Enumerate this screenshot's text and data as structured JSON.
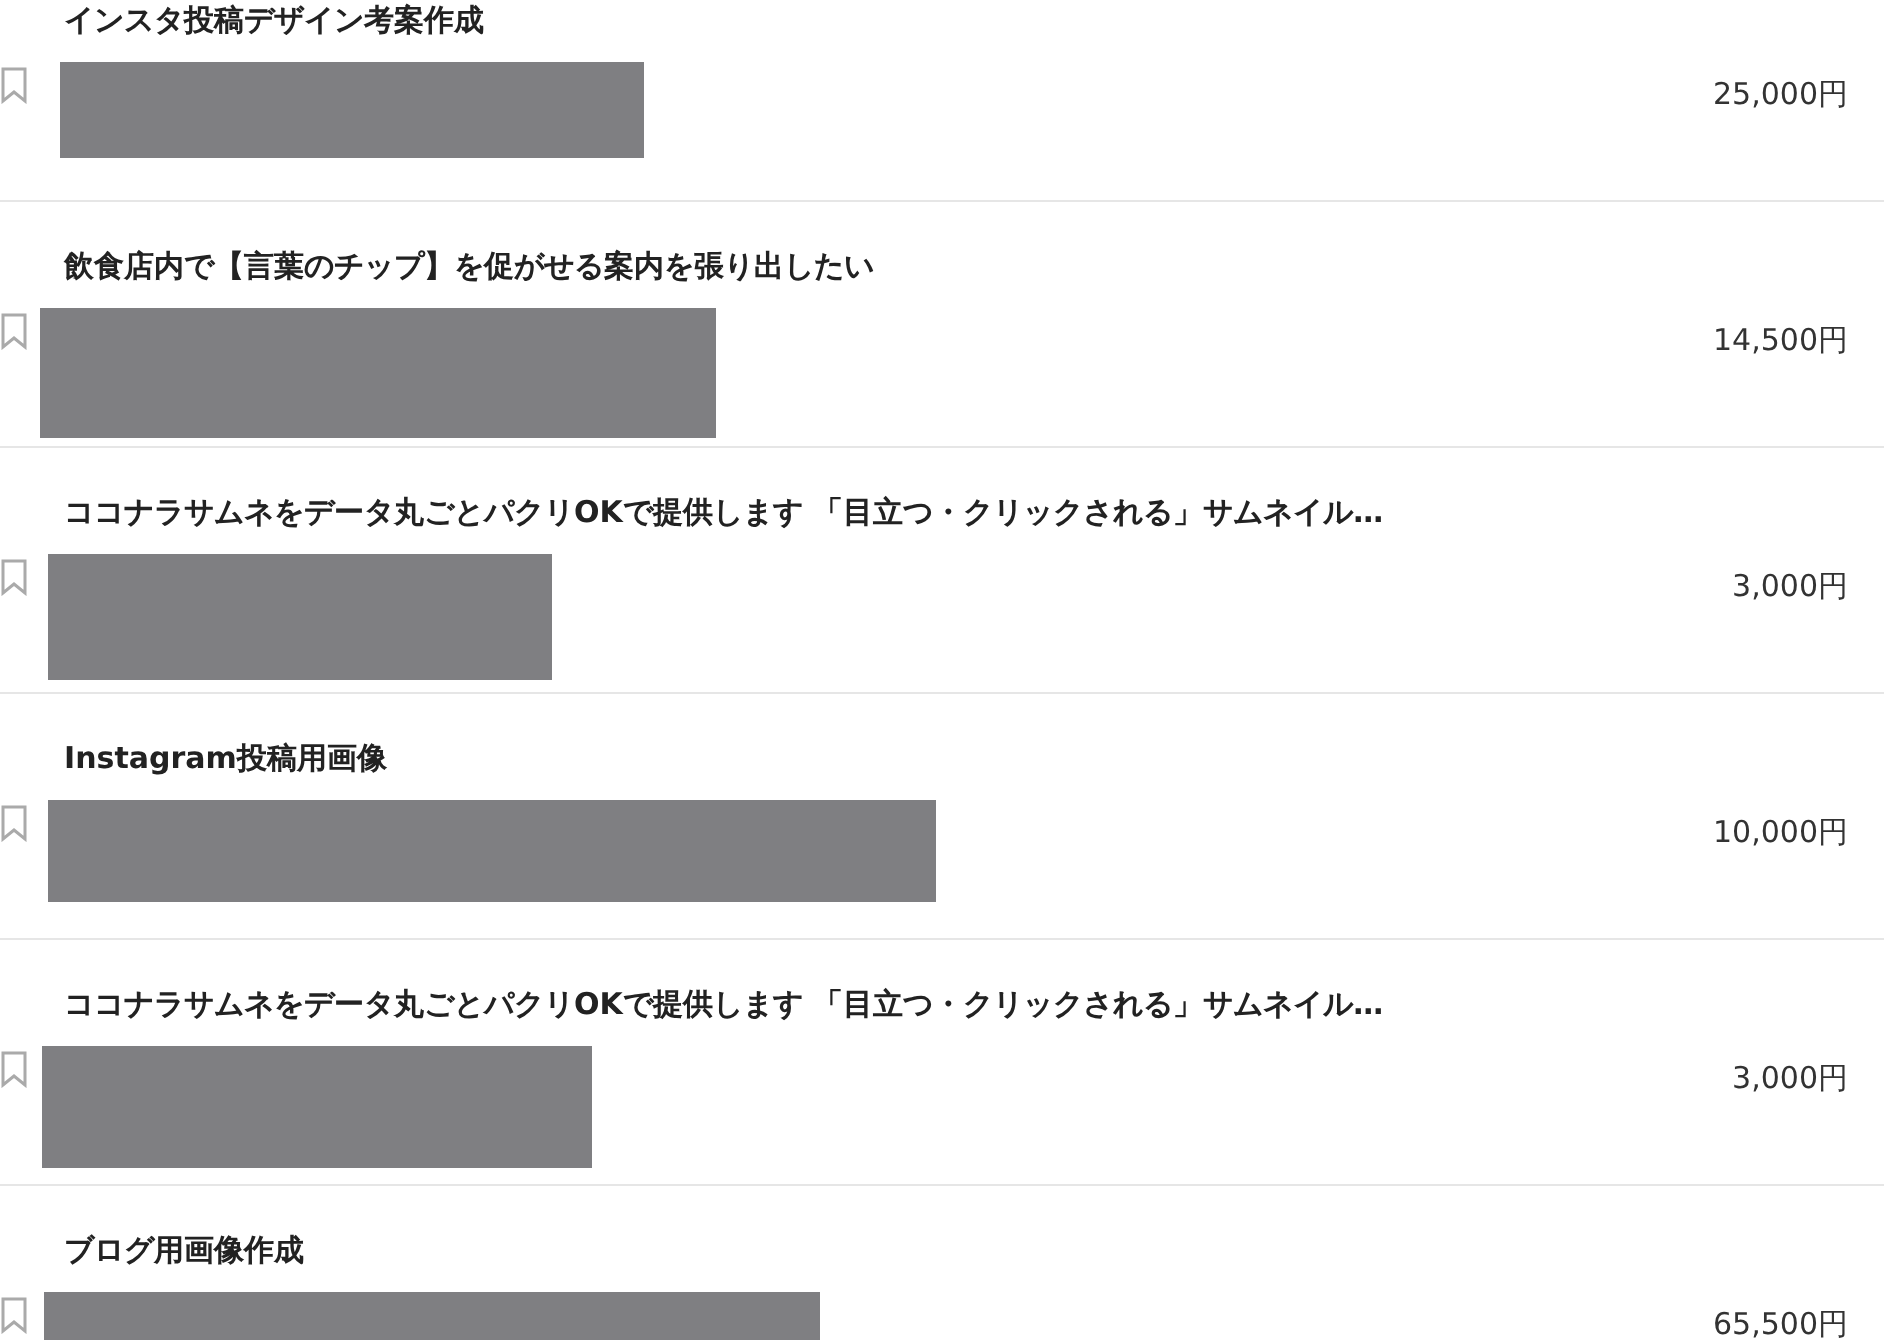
{
  "listings": [
    {
      "title": "インスタ投稿デザイン考案作成",
      "price": "25,000円",
      "bookmarked": false
    },
    {
      "title": "飲食店内で【言葉のチップ】を促がせる案内を張り出したい",
      "price": "14,500円",
      "bookmarked": false
    },
    {
      "title": "ココナラサムネをデータ丸ごとパクリOKで提供します 「目立つ・クリックされる」サムネイル…",
      "price": "3,000円",
      "bookmarked": false
    },
    {
      "title": "Instagram投稿用画像",
      "price": "10,000円",
      "bookmarked": false
    },
    {
      "title": "ココナラサムネをデータ丸ごとパクリOKで提供します 「目立つ・クリックされる」サムネイル…",
      "price": "3,000円",
      "bookmarked": false
    },
    {
      "title": "ブログ用画像作成",
      "price": "65,500円",
      "bookmarked": false
    }
  ]
}
